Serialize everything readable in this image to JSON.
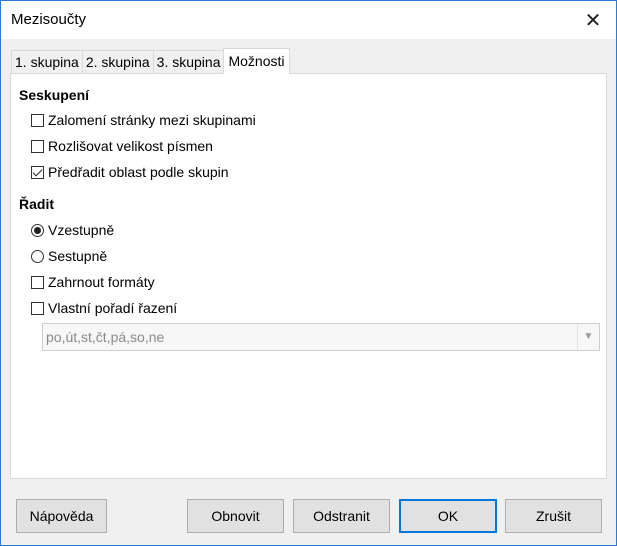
{
  "window": {
    "title": "Mezisoučty"
  },
  "tabs": [
    {
      "label": "1. skupina",
      "active": false
    },
    {
      "label": "2. skupina",
      "active": false
    },
    {
      "label": "3. skupina",
      "active": false
    },
    {
      "label": "Možnosti",
      "active": true
    }
  ],
  "grouping": {
    "heading": "Seskupení",
    "page_break": {
      "label": "Zalomení stránky mezi skupinami",
      "checked": false
    },
    "case_sensitive": {
      "label": "Rozlišovat velikost písmen",
      "checked": false
    },
    "presort": {
      "label": "Předřadit oblast podle skupin",
      "checked": true
    }
  },
  "sort": {
    "heading": "Řadit",
    "ascending": {
      "label": "Vzestupně",
      "selected": true
    },
    "descending": {
      "label": "Sestupně",
      "selected": false
    },
    "include_formats": {
      "label": "Zahrnout formáty",
      "checked": false
    },
    "custom_order": {
      "label": "Vlastní pořadí řazení",
      "checked": false
    },
    "custom_order_value": "po,út,st,čt,pá,so,ne"
  },
  "buttons": {
    "help": "Nápověda",
    "reset": "Obnovit",
    "remove": "Odstranit",
    "ok": "OK",
    "cancel": "Zrušit"
  }
}
